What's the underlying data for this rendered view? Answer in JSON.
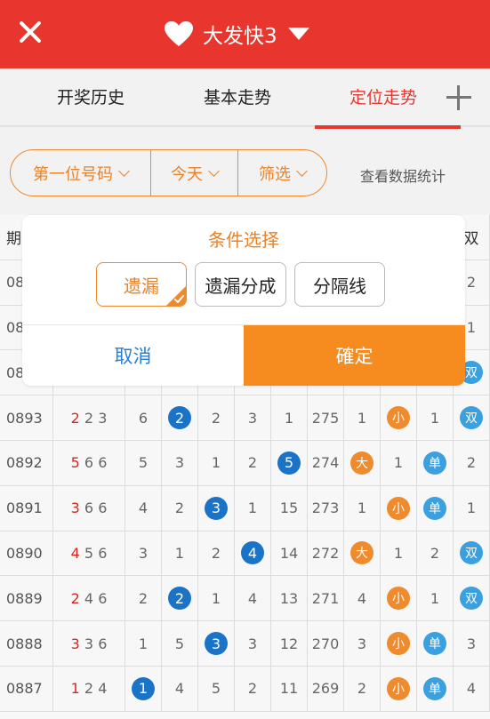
{
  "header": {
    "title": "大发快3",
    "close_icon": "close-icon",
    "heart_icon": "heart-icon",
    "dropdown_icon": "caret-down-icon"
  },
  "tabs": [
    {
      "label": "开奖历史"
    },
    {
      "label": "基本走势"
    },
    {
      "label": "定位走势",
      "active": true
    }
  ],
  "filters": {
    "position": "第一位号码",
    "day": "今天",
    "screen": "筛选",
    "stats_link": "查看数据统计"
  },
  "table": {
    "header_left": "期",
    "header_right": "双",
    "rows": [
      {
        "period": "0893",
        "nums": [
          "2",
          "2",
          "3"
        ],
        "c1": "6",
        "c2": "2",
        "c3": "2",
        "c4": "3",
        "c5": "1",
        "c6": "275",
        "c7": "1",
        "size": "小",
        "c9": "1",
        "parity": "双"
      },
      {
        "period": "0892",
        "nums": [
          "5",
          "6",
          "6"
        ],
        "c1": "5",
        "c2": "3",
        "c3": "1",
        "c4": "2",
        "c5": "5",
        "c6": "274",
        "c7": "大",
        "size": "1",
        "c9": "单",
        "parity": "2"
      },
      {
        "period": "0891",
        "nums": [
          "3",
          "6",
          "6"
        ],
        "c1": "4",
        "c2": "2",
        "c3": "3",
        "c4": "1",
        "c5": "15",
        "c6": "273",
        "c7": "1",
        "size": "小",
        "c9": "单",
        "parity": "1"
      },
      {
        "period": "0890",
        "nums": [
          "4",
          "5",
          "6"
        ],
        "c1": "3",
        "c2": "1",
        "c3": "2",
        "c4": "4",
        "c5": "14",
        "c6": "272",
        "c7": "大",
        "size": "1",
        "c9": "2",
        "parity": "双"
      },
      {
        "period": "0889",
        "nums": [
          "2",
          "4",
          "6"
        ],
        "c1": "2",
        "c2": "2",
        "c3": "1",
        "c4": "4",
        "c5": "13",
        "c6": "271",
        "c7": "4",
        "size": "小",
        "c9": "1",
        "parity": "双"
      },
      {
        "period": "0888",
        "nums": [
          "3",
          "3",
          "6"
        ],
        "c1": "1",
        "c2": "5",
        "c3": "3",
        "c4": "3",
        "c5": "12",
        "c6": "270",
        "c7": "3",
        "size": "小",
        "c9": "单",
        "parity": "3"
      },
      {
        "period": "0887",
        "nums": [
          "1",
          "2",
          "4"
        ],
        "c1": "1",
        "c2": "4",
        "c3": "5",
        "c4": "2",
        "c5": "11",
        "c6": "269",
        "c7": "2",
        "size": "小",
        "c9": "单",
        "parity": "4"
      }
    ],
    "partial_rows": [
      {
        "period": "08",
        "right": "2"
      },
      {
        "period": "08",
        "right": "1"
      },
      {
        "period": "08",
        "right": "双"
      }
    ]
  },
  "modal": {
    "title": "条件选择",
    "options": [
      "遗漏",
      "遗漏分成",
      "分隔线"
    ],
    "selected": "遗漏",
    "cancel": "取消",
    "confirm": "確定"
  },
  "colors": {
    "brand_red": "#e8362f",
    "accent_orange": "#f68b1f",
    "ball_blue": "#1a73c6",
    "ball_orange": "#ef8b2c",
    "ball_light_blue": "#3aa0e0",
    "cancel_blue": "#2a7dd1"
  }
}
